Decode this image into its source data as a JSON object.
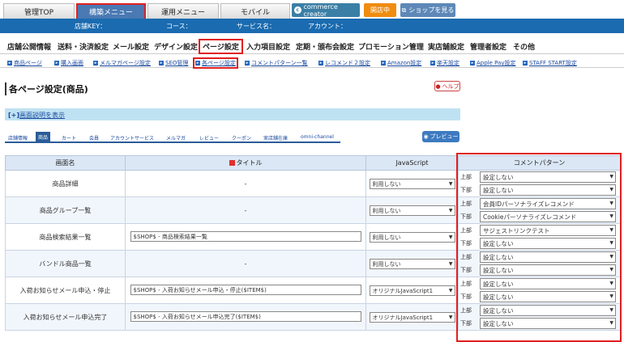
{
  "tabs": [
    "管理TOP",
    "構築メニュー",
    "運用メニュー",
    "モバイル"
  ],
  "commerce_creator": "commerce creator",
  "open_status": "開店中",
  "shop_view": "ショップを見る",
  "info": {
    "key": "店舗KEY：",
    "course": "コース：",
    "service": "サービス名：",
    "account": "アカウント："
  },
  "menu": [
    "店舗公開情報",
    "送料・決済設定",
    "メール設定",
    "デザイン設定",
    "ページ設定",
    "入力項目設定",
    "定期・頒布会設定",
    "プロモーション管理",
    "実店舗設定",
    "管理者設定",
    "その他"
  ],
  "submenu": [
    "商品ページ",
    "購入画面",
    "メルマガページ設定",
    "SEO管理",
    "各ページ設定",
    "コメントパターン一覧",
    "レコメンド２設定",
    "Amazon設定",
    "楽天設定",
    "Apple Pay設定",
    "STAFF START設定"
  ],
  "page_title": "各ページ設定(商品)",
  "help": "ヘルプ",
  "explain_prefix": "[+]",
  "explain": "画面説明を表示",
  "subtabs": [
    "店舗情報",
    "商品",
    "カート",
    "会員",
    "アカウントサービス",
    "メルマガ",
    "レビュー",
    "クーポン",
    "実店舗在庫",
    "omni-channel"
  ],
  "preview": "プレビュー",
  "headers": [
    "画面名",
    "タイトル",
    "JavaScript",
    "コメントパターン"
  ],
  "upper": "上部",
  "lower": "下部",
  "rows": [
    {
      "name": "商品詳細",
      "title": "-",
      "js": "利用しない",
      "top": "設定しない",
      "bottom": "設定しない"
    },
    {
      "name": "商品グループ一覧",
      "title": "-",
      "js": "利用しない",
      "top": "会員IDパーソナライズレコメンド",
      "bottom": "Cookieパーソナライズレコメンド"
    },
    {
      "name": "商品検索結果一覧",
      "title": "$SHOP$ - 商品検索結果一覧",
      "js": "利用しない",
      "top": "サジェストリンクテスト",
      "bottom": "設定しない"
    },
    {
      "name": "バンドル商品一覧",
      "title": "-",
      "js": "利用しない",
      "top": "設定しない",
      "bottom": "設定しない"
    },
    {
      "name": "入荷お知らせメール申込・停止",
      "title": "$SHOP$ - 入荷お知らせメール申込・停止($ITEM$)",
      "js": "オリジナルJavaScript1",
      "top": "設定しない",
      "bottom": "設定しない"
    },
    {
      "name": "入荷お知らせメール申込完了",
      "title": "$SHOP$ - 入荷お知らせメール申込完了($ITEM$)",
      "js": "オリジナルJavaScript1",
      "top": "設定しない",
      "bottom": "設定しない"
    }
  ]
}
